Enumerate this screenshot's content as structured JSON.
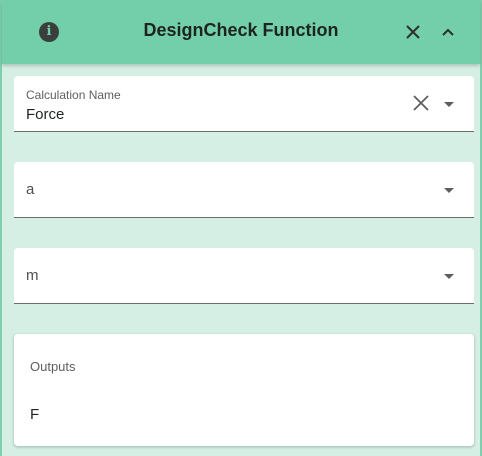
{
  "header": {
    "title": "DesignCheck Function",
    "info_icon": "info-icon",
    "close_icon": "close-icon",
    "collapse_icon": "chevron-up-icon"
  },
  "calculation": {
    "label": "Calculation Name",
    "value": "Force"
  },
  "inputs": [
    {
      "placeholder": "a"
    },
    {
      "placeholder": "m"
    }
  ],
  "outputs": {
    "title": "Outputs",
    "items": [
      "F"
    ]
  },
  "colors": {
    "header_bg": "#73cfaa",
    "panel_bg": "#d6efe4",
    "text": "#1e2421"
  }
}
